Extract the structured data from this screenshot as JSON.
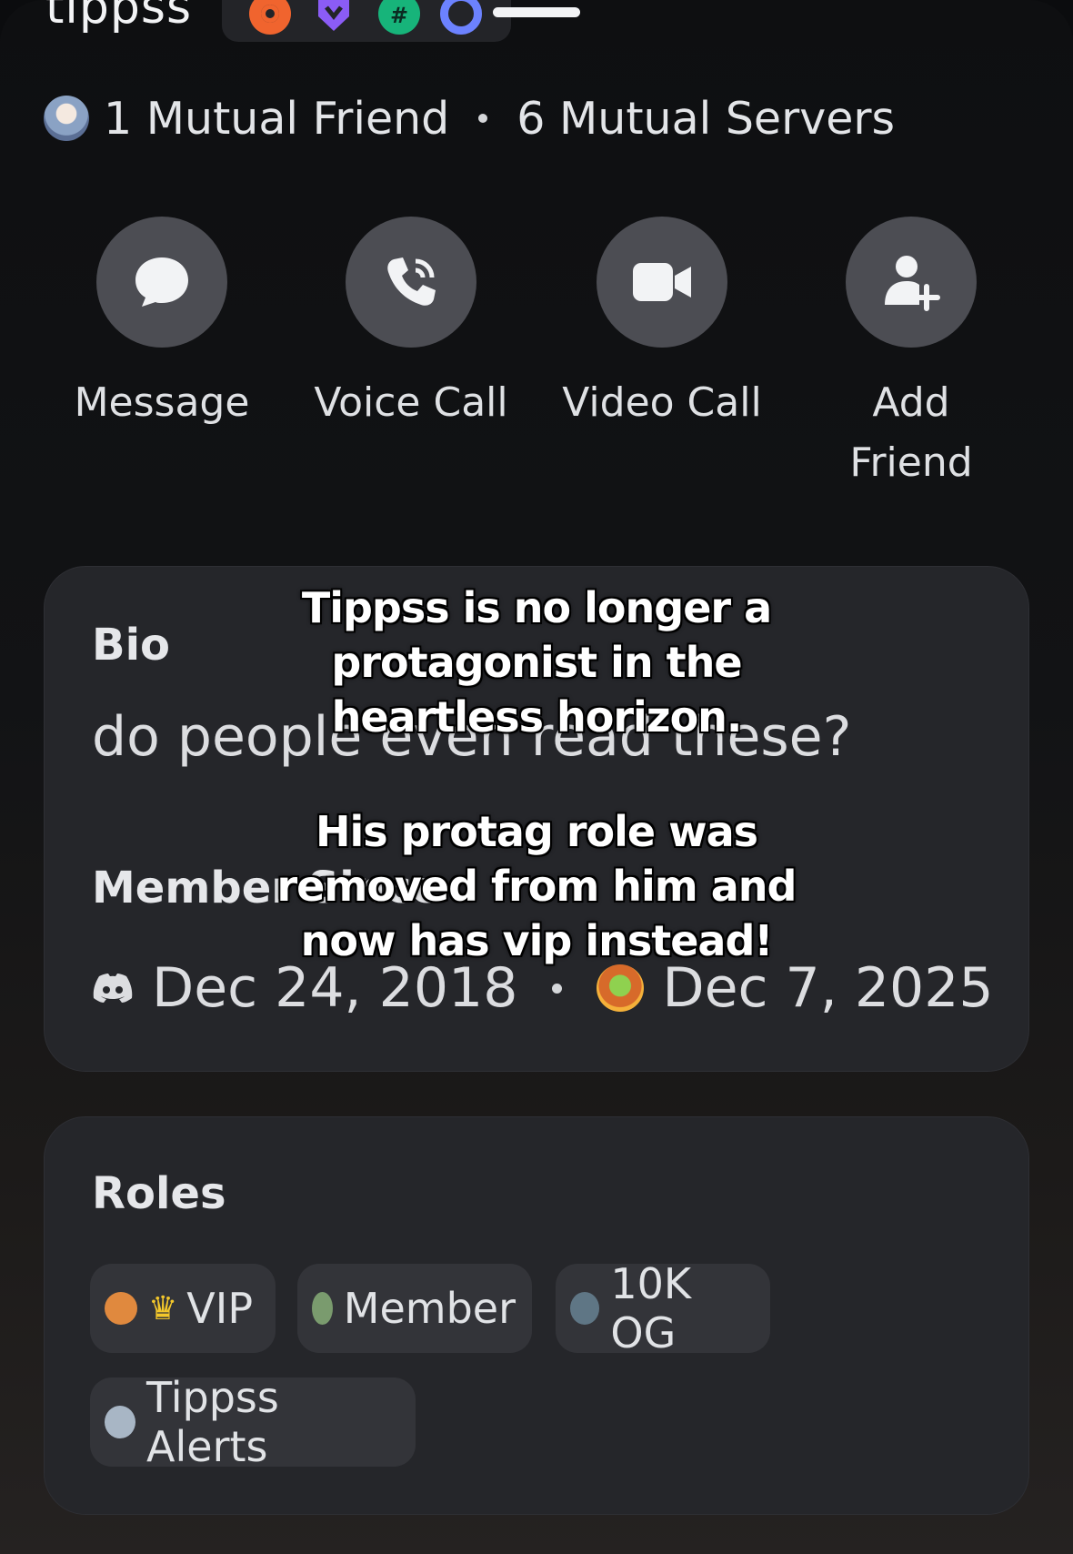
{
  "profile": {
    "username": "tippss",
    "badges": [
      "hypesquad-badge-orange",
      "nitro-badge-purple",
      "server-tag-badge-green",
      "quest-badge-blue"
    ]
  },
  "mutual": {
    "friends": "1 Mutual Friend",
    "servers": "6 Mutual Servers"
  },
  "actions": [
    {
      "label": "Message",
      "icon": "chat-bubble-icon"
    },
    {
      "label": "Voice Call",
      "icon": "phone-icon"
    },
    {
      "label": "Video Call",
      "icon": "video-camera-icon"
    },
    {
      "label": "Add Friend",
      "icon": "add-friend-icon"
    }
  ],
  "bio": {
    "title": "Bio",
    "text": "do people even read these?"
  },
  "member_since": {
    "title": "Member Since",
    "discord_date": "Dec 24, 2018",
    "server_date": "Dec 7, 2025"
  },
  "roles": {
    "title": "Roles",
    "items": [
      {
        "name": "VIP",
        "color": "#e0893e",
        "crown": "♛"
      },
      {
        "name": "Member",
        "color": "#7a9b6e"
      },
      {
        "name": "10K OG",
        "color": "#5f7685"
      },
      {
        "name": "Tippss Alerts",
        "color": "#a8b6c5"
      }
    ]
  },
  "overlay": {
    "line1": "Tippss is no longer a protagonist in the heartless horizon.",
    "line2": "His protag role was removed from him and now has vip instead!"
  }
}
